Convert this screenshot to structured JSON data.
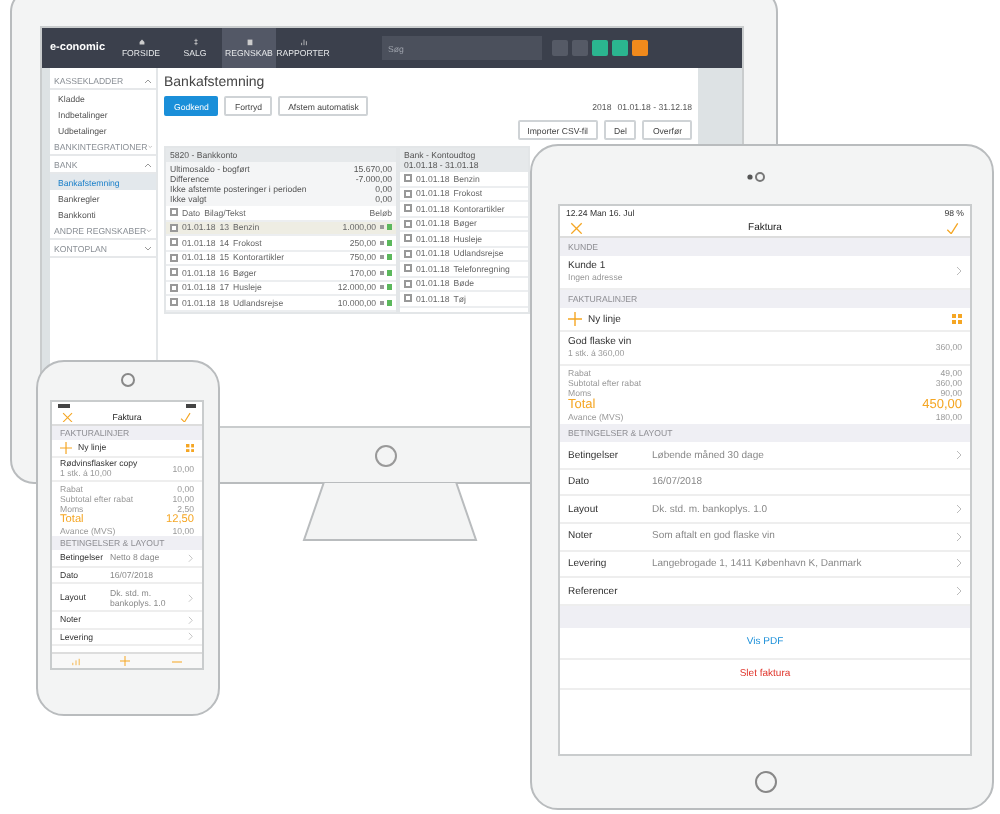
{
  "desktop": {
    "brand": "e-conomic",
    "nav": [
      {
        "label": "FORSIDE",
        "selected": false
      },
      {
        "label": "SALG",
        "selected": false
      },
      {
        "label": "REGNSKAB",
        "selected": true
      },
      {
        "label": "RAPPORTER",
        "selected": false
      }
    ],
    "search": {
      "placeholder": "Søg"
    },
    "sidebar": [
      {
        "label": "KASSEKLADDER",
        "expanded": true,
        "children": [
          {
            "label": "Kladde",
            "selected": false
          },
          {
            "label": "Indbetalinger",
            "selected": false
          },
          {
            "label": "Udbetalinger",
            "selected": false
          }
        ]
      },
      {
        "label": "BANKINTEGRATIONER",
        "expanded": false
      },
      {
        "label": "BANK",
        "expanded": true,
        "children": [
          {
            "label": "Bankafstemning",
            "selected": true
          },
          {
            "label": "Bankregler",
            "selected": false
          },
          {
            "label": "Bankkonti",
            "selected": false
          }
        ]
      },
      {
        "label": "ANDRE REGNSKABER",
        "expanded": false
      },
      {
        "label": "KONTOPLAN",
        "expanded": false
      }
    ],
    "title": "Bankafstemning",
    "actions": [
      {
        "label": "Godkend",
        "primary": true
      },
      {
        "label": "Fortryd",
        "primary": false
      },
      {
        "label": "Afstem automatisk",
        "primary": false
      }
    ],
    "year": "2018",
    "period": "01.01.18 - 31.12.18",
    "tools": [
      "Importer CSV-fil",
      "Del",
      "Overfør"
    ],
    "account": "5820 - Bankkonto",
    "statement": "Bank - Kontoudtog",
    "statement_period": "01.01.18 - 31.01.18",
    "summary": [
      {
        "label": "Ultimosaldo - bogført",
        "value": "15.670,00"
      },
      {
        "label": "Difference",
        "value": "-7.000,00"
      },
      {
        "label": "Ikke afstemte posteringer i perioden",
        "value": "0,00"
      },
      {
        "label": "Ikke valgt",
        "value": "0,00"
      }
    ],
    "select_all": false,
    "columns": [
      "Dato",
      "Bilag/Tekst",
      "Beløb"
    ],
    "rows": [
      {
        "date": "01.01.18",
        "no": "13",
        "text": "Benzin",
        "amount": "1.000,00",
        "selected": true,
        "checked": false
      },
      {
        "date": "01.01.18",
        "no": "14",
        "text": "Frokost",
        "amount": "250,00",
        "selected": false,
        "checked": false
      },
      {
        "date": "01.01.18",
        "no": "15",
        "text": "Kontorartikler",
        "amount": "750,00",
        "selected": false,
        "checked": false
      },
      {
        "date": "01.01.18",
        "no": "16",
        "text": "Bøger",
        "amount": "170,00",
        "selected": false,
        "checked": false
      },
      {
        "date": "01.01.18",
        "no": "17",
        "text": "Husleje",
        "amount": "12.000,00",
        "selected": false,
        "checked": false
      },
      {
        "date": "01.01.18",
        "no": "18",
        "text": "Udlandsrejse",
        "amount": "10.000,00",
        "selected": false,
        "checked": false
      }
    ],
    "bank_rows": [
      {
        "date": "01.01.18",
        "text": "Benzin",
        "checked": false
      },
      {
        "date": "01.01.18",
        "text": "Frokost",
        "checked": false
      },
      {
        "date": "01.01.18",
        "text": "Kontorartikler",
        "checked": false
      },
      {
        "date": "01.01.18",
        "text": "Bøger",
        "checked": false
      },
      {
        "date": "01.01.18",
        "text": "Husleje",
        "checked": false
      },
      {
        "date": "01.01.18",
        "text": "Udlandsrejse",
        "checked": false
      },
      {
        "date": "01.01.18",
        "text": "Telefonregning",
        "checked": false
      },
      {
        "date": "01.01.18",
        "text": "Bøde",
        "checked": false
      },
      {
        "date": "01.01.18",
        "text": "Tøj",
        "checked": false
      }
    ]
  },
  "tablet": {
    "status_time": "12.24 Man 16. Jul",
    "battery": "98 %",
    "title": "Faktura",
    "customer_header": "KUNDE",
    "customer": "Kunde 1",
    "customer_note": "Ingen adresse",
    "lines_header": "FAKTURALINJER",
    "new_line": "Ny linje",
    "item": {
      "name": "God flaske vin",
      "detail": "1 stk. á 360,00",
      "amount": "360,00"
    },
    "totals": [
      {
        "label": "Rabat",
        "value": "49,00"
      },
      {
        "label": "Subtotal efter rabat",
        "value": "360,00"
      },
      {
        "label": "Moms",
        "value": "90,00"
      }
    ],
    "total": {
      "label": "Total",
      "value": "450,00"
    },
    "extra": {
      "label": "Avance (MVS)",
      "value": "180,00"
    },
    "terms_header": "BETINGELSER & LAYOUT",
    "fields": [
      {
        "label": "Betingelser",
        "value": "Løbende måned 30 dage",
        "arrow": true
      },
      {
        "label": "Dato",
        "value": "16/07/2018",
        "arrow": false
      },
      {
        "label": "Layout",
        "value": "Dk. std. m. bankoplys. 1.0",
        "arrow": true
      },
      {
        "label": "Noter",
        "value": "Som aftalt en god flaske vin",
        "arrow": true
      },
      {
        "label": "Levering",
        "value": "Langebrogade 1, 1411 København K, Danmark",
        "arrow": true
      },
      {
        "label": "Referencer",
        "arrow": true
      }
    ],
    "pdf": "Vis PDF",
    "delete": "Slet faktura"
  },
  "phone": {
    "title": "Faktura",
    "lines_header": "FAKTURALINJER",
    "new_line": "Ny linje",
    "item": {
      "name": "Rødvinsflasker copy",
      "detail": "1 stk. á 10,00",
      "amount": "10,00"
    },
    "totals": [
      {
        "label": "Rabat",
        "value": "0,00"
      },
      {
        "label": "Subtotal efter rabat",
        "value": "10,00"
      },
      {
        "label": "Moms",
        "value": "2,50"
      }
    ],
    "total": {
      "label": "Total",
      "value": "12,50"
    },
    "extra": {
      "label": "Avance (MVS)",
      "value": "10,00"
    },
    "terms_header": "BETINGELSER & LAYOUT",
    "fields": [
      {
        "label": "Betingelser",
        "value": "Netto 8 dage",
        "arrow": true
      },
      {
        "label": "Dato",
        "value": "16/07/2018",
        "arrow": false
      },
      {
        "label": "Layout",
        "value": "Dk. std. m. bankoplys. 1.0",
        "arrow": true
      },
      {
        "label": "Noter",
        "arrow": true
      },
      {
        "label": "Levering",
        "arrow": true
      }
    ]
  }
}
